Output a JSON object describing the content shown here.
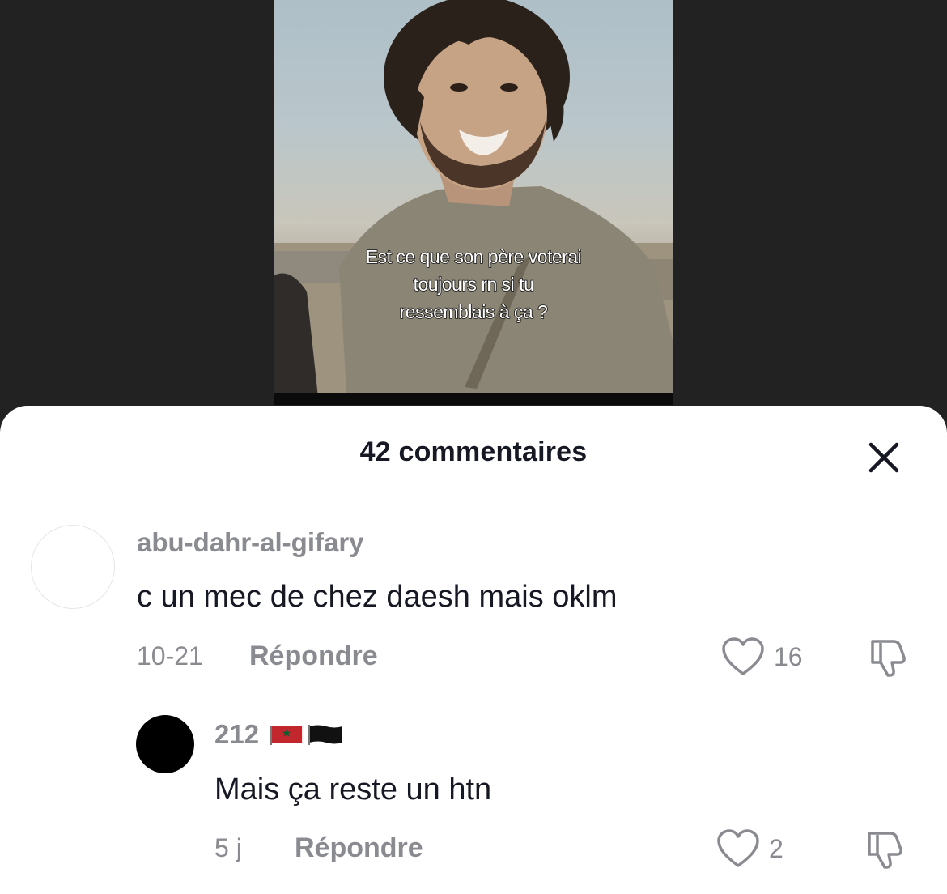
{
  "video": {
    "caption_lines": [
      "Est ce que son père voterai",
      "toujours rn si tu",
      "ressemblais à ça ?"
    ]
  },
  "sheet": {
    "title": "42 commentaires",
    "close_icon": "close-icon"
  },
  "comments": [
    {
      "username": "abu-dahr-al-gifary",
      "text": "c un mec de chez daesh mais oklm",
      "date": "10-21",
      "reply_label": "Répondre",
      "likes": "16"
    },
    {
      "username": "212",
      "username_flags": [
        "morocco-flag",
        "black-flag"
      ],
      "text": "Mais ça reste un htn",
      "date": "5 j",
      "reply_label": "Répondre",
      "likes": "2"
    }
  ],
  "colors": {
    "text_primary": "#161823",
    "text_secondary": "#8a8b91",
    "sheet_bg": "#ffffff",
    "page_bg": "#232323"
  }
}
